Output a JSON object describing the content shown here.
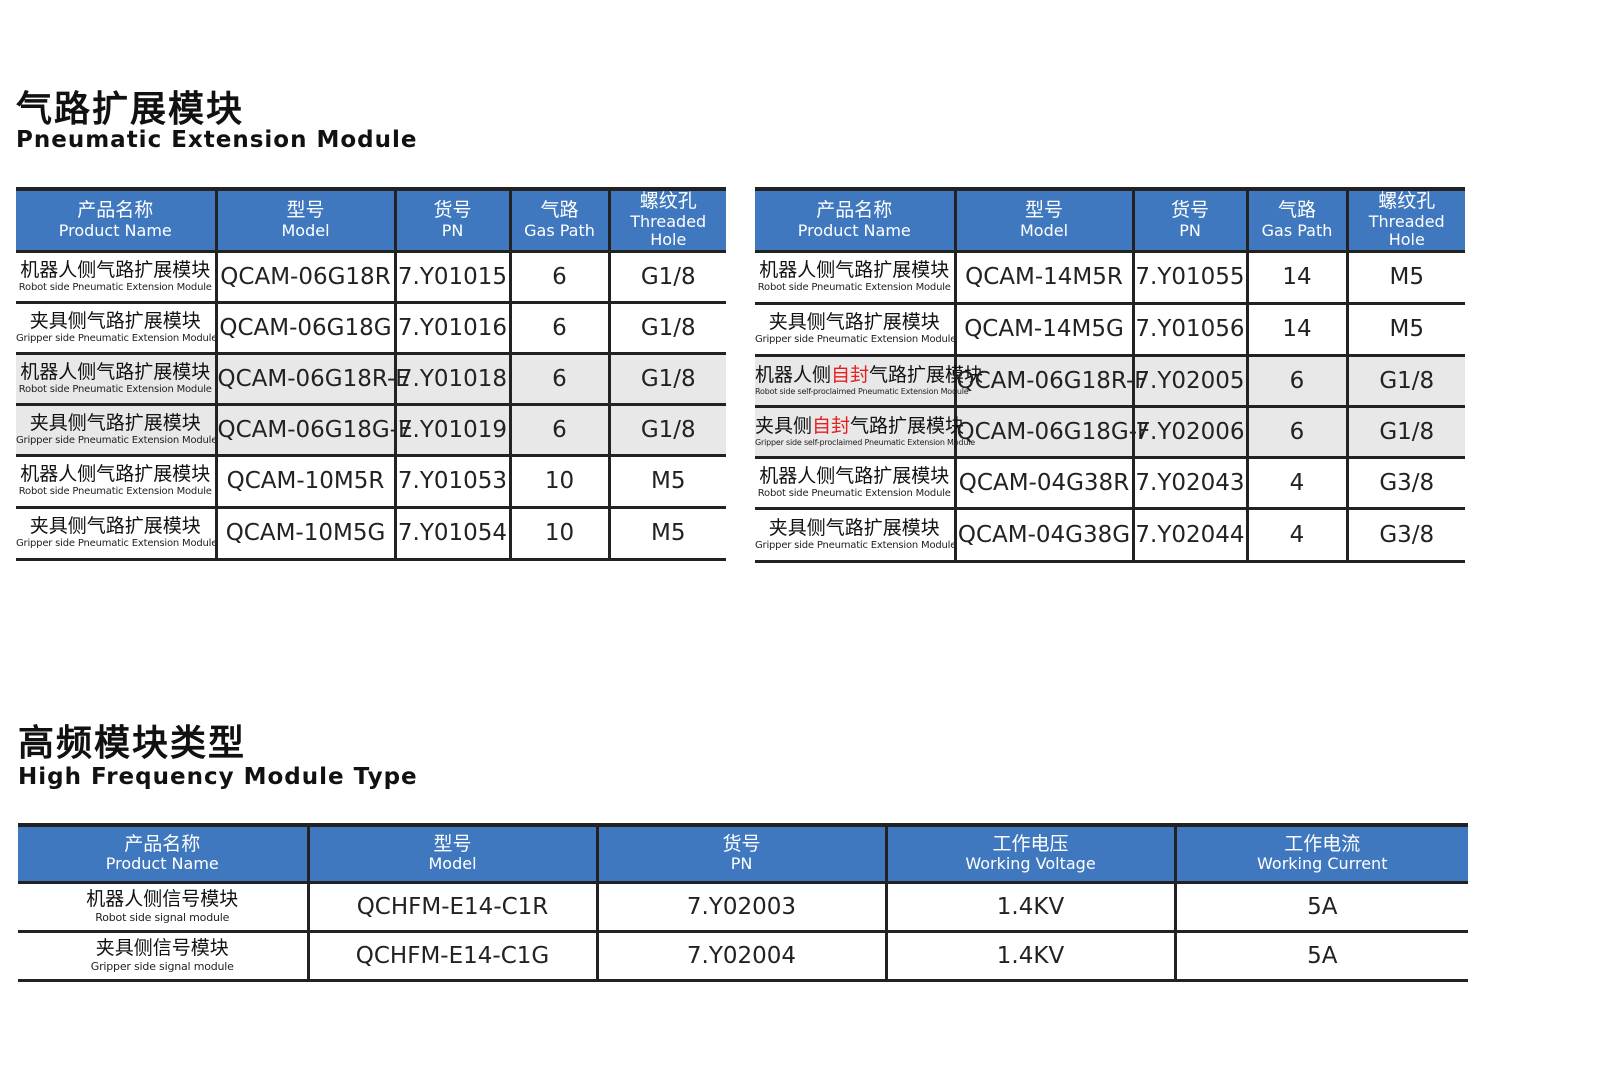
{
  "pneumatic": {
    "title_cn": "气路扩展模块",
    "title_en": "Pneumatic Extension Module",
    "headers": [
      {
        "cn": "产品名称",
        "en": "Product Name"
      },
      {
        "cn": "型号",
        "en": "Model"
      },
      {
        "cn": "货号",
        "en": "PN"
      },
      {
        "cn": "气路",
        "en": "Gas Path"
      },
      {
        "cn": "螺纹孔",
        "en": "Threaded Hole"
      }
    ],
    "left_rows": [
      {
        "name_cn": "机器人侧气路扩展模块",
        "name_en": "Robot side Pneumatic Extension Module",
        "model": "QCAM-06G18R",
        "pn": "7.Y01015",
        "gas": "6",
        "thread": "G1/8"
      },
      {
        "name_cn": "夹具侧气路扩展模块",
        "name_en": "Gripper side Pneumatic Extension Module",
        "model": "QCAM-06G18G",
        "pn": "7.Y01016",
        "gas": "6",
        "thread": "G1/8"
      },
      {
        "name_cn": "机器人侧气路扩展模块",
        "name_en": "Robot side Pneumatic Extension Module",
        "model": "QCAM-06G18R-E",
        "pn": "7.Y01018",
        "gas": "6",
        "thread": "G1/8"
      },
      {
        "name_cn": "夹具侧气路扩展模块",
        "name_en": "Gripper side Pneumatic Extension Module",
        "model": "QCAM-06G18G-E",
        "pn": "7.Y01019",
        "gas": "6",
        "thread": "G1/8"
      },
      {
        "name_cn": "机器人侧气路扩展模块",
        "name_en": "Robot side Pneumatic Extension Module",
        "model": "QCAM-10M5R",
        "pn": "7.Y01053",
        "gas": "10",
        "thread": "M5"
      },
      {
        "name_cn": "夹具侧气路扩展模块",
        "name_en": "Gripper side Pneumatic Extension Module",
        "model": "QCAM-10M5G",
        "pn": "7.Y01054",
        "gas": "10",
        "thread": "M5"
      }
    ],
    "right_rows": [
      {
        "name_cn": "机器人侧气路扩展模块",
        "name_en": "Robot side Pneumatic Extension Module",
        "model": "QCAM-14M5R",
        "pn": "7.Y01055",
        "gas": "14",
        "thread": "M5"
      },
      {
        "name_cn": "夹具侧气路扩展模块",
        "name_en": "Gripper side Pneumatic Extension Module",
        "model": "QCAM-14M5G",
        "pn": "7.Y01056",
        "gas": "14",
        "thread": "M5"
      },
      {
        "name_cn_a": "机器人侧",
        "name_cn_hl": "自封",
        "name_cn_b": "气路扩展模块",
        "name_en": "Robot side self-proclaimed Pneumatic Extension Module",
        "model": "QCAM-06G18R-F",
        "pn": "7.Y02005",
        "gas": "6",
        "thread": "G1/8"
      },
      {
        "name_cn_a": "夹具侧",
        "name_cn_hl": "自封",
        "name_cn_b": "气路扩展模块",
        "name_en": "Gripper side self-proclaimed Pneumatic Extension Module",
        "model": "QCAM-06G18G-F",
        "pn": "7.Y02006",
        "gas": "6",
        "thread": "G1/8"
      },
      {
        "name_cn": "机器人侧气路扩展模块",
        "name_en": "Robot side Pneumatic Extension Module",
        "model": "QCAM-04G38R",
        "pn": "7.Y02043",
        "gas": "4",
        "thread": "G3/8"
      },
      {
        "name_cn": "夹具侧气路扩展模块",
        "name_en": "Gripper side Pneumatic Extension Module",
        "model": "QCAM-04G38G",
        "pn": "7.Y02044",
        "gas": "4",
        "thread": "G3/8"
      }
    ]
  },
  "hf": {
    "title_cn": "高频模块类型",
    "title_en": "High Frequency Module Type",
    "headers": [
      {
        "cn": "产品名称",
        "en": "Product Name"
      },
      {
        "cn": "型号",
        "en": "Model"
      },
      {
        "cn": "货号",
        "en": "PN"
      },
      {
        "cn": "工作电压",
        "en": "Working Voltage"
      },
      {
        "cn": "工作电流",
        "en": "Working Current"
      }
    ],
    "rows": [
      {
        "name_cn": "机器人侧信号模块",
        "name_en": "Robot side signal module",
        "model": "QCHFM-E14-C1R",
        "pn": "7.Y02003",
        "voltage": "1.4KV",
        "current": "5A"
      },
      {
        "name_cn": "夹具侧信号模块",
        "name_en": "Gripper side signal module",
        "model": "QCHFM-E14-C1G",
        "pn": "7.Y02004",
        "voltage": "1.4KV",
        "current": "5A"
      }
    ]
  }
}
